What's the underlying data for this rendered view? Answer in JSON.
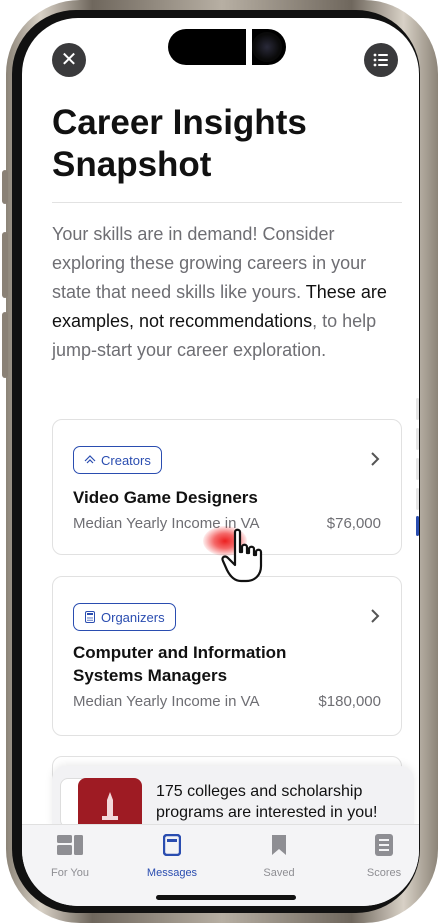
{
  "header": {
    "title": "Career Insights Snapshot",
    "close_icon": "close-icon",
    "menu_icon": "list-icon"
  },
  "intro": {
    "part1": "Your skills are in demand! Consider exploring these growing careers in your state that need skills like yours. ",
    "emphasis": "These are examples, not recommendations",
    "part2": ", to help jump-start your career exploration."
  },
  "careers": [
    {
      "category": "Creators",
      "category_icon": "palette-icon",
      "title": "Video Game Designers",
      "income_label": "Median Yearly Income in VA",
      "income_value": "$76,000"
    },
    {
      "category": "Organizers",
      "category_icon": "calculator-icon",
      "title": "Computer and Information Systems Managers",
      "income_label": "Median Yearly Income in VA",
      "income_value": "$180,000"
    }
  ],
  "banner": {
    "text": "175 colleges and scholarship programs are interested in you!"
  },
  "tabbar": {
    "tabs": [
      {
        "label": "For You",
        "icon": "dashboard-icon",
        "active": false
      },
      {
        "label": "Messages",
        "icon": "message-icon",
        "active": true
      },
      {
        "label": "Saved",
        "icon": "bookmark-icon",
        "active": false
      },
      {
        "label": "Scores",
        "icon": "scores-icon",
        "active": false
      }
    ]
  },
  "colors": {
    "accent": "#2a4db0",
    "tap_indicator": "#e81414",
    "banner_logo": "#9e1b23"
  }
}
